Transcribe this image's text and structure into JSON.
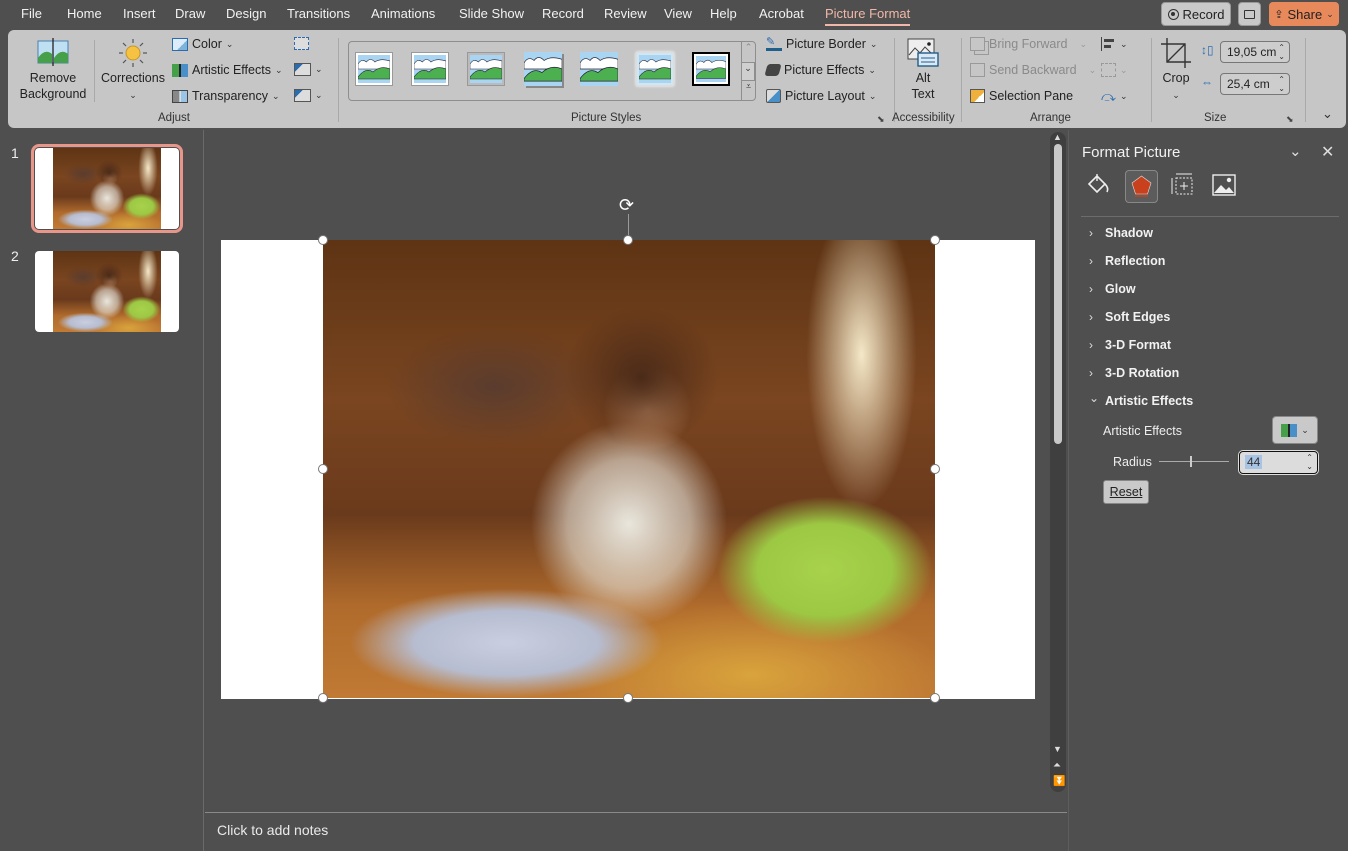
{
  "tabs": [
    {
      "label": "File",
      "active": false
    },
    {
      "label": "Home",
      "active": false
    },
    {
      "label": "Insert",
      "active": false
    },
    {
      "label": "Draw",
      "active": false
    },
    {
      "label": "Design",
      "active": false
    },
    {
      "label": "Transitions",
      "active": false
    },
    {
      "label": "Animations",
      "active": false
    },
    {
      "label": "Slide Show",
      "active": false
    },
    {
      "label": "Record",
      "active": false
    },
    {
      "label": "Review",
      "active": false
    },
    {
      "label": "View",
      "active": false
    },
    {
      "label": "Help",
      "active": false
    },
    {
      "label": "Acrobat",
      "active": false
    },
    {
      "label": "Picture Format",
      "active": true
    }
  ],
  "topbar": {
    "record_label": "Record",
    "share_label": "Share",
    "share_color": "#e8895c",
    "accent_color": "#f0b8a8"
  },
  "ribbon": {
    "adjust": {
      "label": "Adjust",
      "remove_background_l1": "Remove",
      "remove_background_l2": "Background",
      "corrections": "Corrections",
      "color": "Color",
      "artistic_effects": "Artistic Effects",
      "transparency": "Transparency"
    },
    "picture_styles": {
      "label": "Picture Styles",
      "picture_border": "Picture Border",
      "picture_effects": "Picture Effects",
      "picture_layout": "Picture Layout"
    },
    "accessibility": {
      "label": "Accessibility",
      "alt_text_l1": "Alt",
      "alt_text_l2": "Text"
    },
    "arrange": {
      "label": "Arrange",
      "bring_forward": "Bring Forward",
      "send_backward": "Send Backward",
      "selection_pane": "Selection Pane"
    },
    "size": {
      "label": "Size",
      "crop": "Crop",
      "height": "19,05 cm",
      "width": "25,4 cm"
    }
  },
  "slides": [
    {
      "number": "1",
      "selected": true
    },
    {
      "number": "2",
      "selected": false
    }
  ],
  "notes": {
    "placeholder": "Click to add notes"
  },
  "format_pane": {
    "title": "Format Picture",
    "sections": [
      {
        "label": "Shadow",
        "expanded": false
      },
      {
        "label": "Reflection",
        "expanded": false
      },
      {
        "label": "Glow",
        "expanded": false
      },
      {
        "label": "Soft Edges",
        "expanded": false
      },
      {
        "label": "3-D Format",
        "expanded": false
      },
      {
        "label": "3-D Rotation",
        "expanded": false
      },
      {
        "label": "Artistic Effects",
        "expanded": true
      }
    ],
    "artistic_effects_label": "Artistic Effects",
    "radius_label": "Radius",
    "radius_value": "44",
    "reset_label": "Reset"
  }
}
